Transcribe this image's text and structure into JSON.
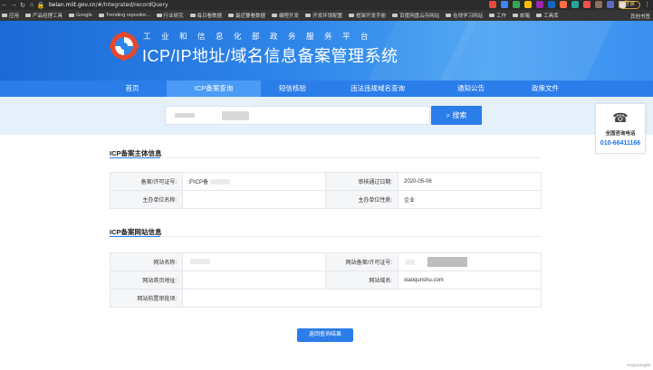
{
  "browser": {
    "url_host": "beian.miit.gov.cn",
    "url_path": "/#/Integrated/recordQuery",
    "login_label": "登录",
    "bookmarks": [
      "应用",
      "产品经理工具",
      "Google",
      "Trending repositor...",
      "行业研究",
      "每日看数据",
      "最近要看数据",
      "编程开发",
      "开发环境配置",
      "框架开发手册",
      "百度网盘云存网站",
      "在线学习网站",
      "工作",
      "邮箱",
      "工具库"
    ],
    "other_bookmarks": "其他书签"
  },
  "header": {
    "subtitle": "工业和信息化部政务服务平台",
    "title": "ICP/IP地址/域名信息备案管理系统"
  },
  "nav": {
    "items": [
      "首页",
      "ICP备案查询",
      "短信核验",
      "违法违规域名查询",
      "通知公告",
      "政策文件"
    ]
  },
  "search": {
    "button": "搜索"
  },
  "hotline": {
    "label": "全国咨询电话",
    "number": "010-66411166"
  },
  "subject": {
    "section_title": "ICP备案主体信息",
    "license_label": "备案/许可证号:",
    "license_value": "沪ICP备",
    "approve_date_label": "审核通过日期:",
    "approve_date_value": "2020-05-06",
    "org_name_label": "主办单位名称:",
    "org_nature_label": "主办单位性质:",
    "org_nature_value": "企业"
  },
  "website": {
    "section_title": "ICP备案网站信息",
    "name_label": "网站名称:",
    "site_license_label": "网站备案/许可证号:",
    "home_url_label": "网站首页地址:",
    "domain_label": "网站域名:",
    "domain_value": "xiaoqunshu.com",
    "approval_label": "网站前置审批项:"
  },
  "back_button": "返回查询结果",
  "watermark": "#AppSang99",
  "colors": {
    "accent": "#2b7de9",
    "hotline_number": "#1a73e8"
  }
}
